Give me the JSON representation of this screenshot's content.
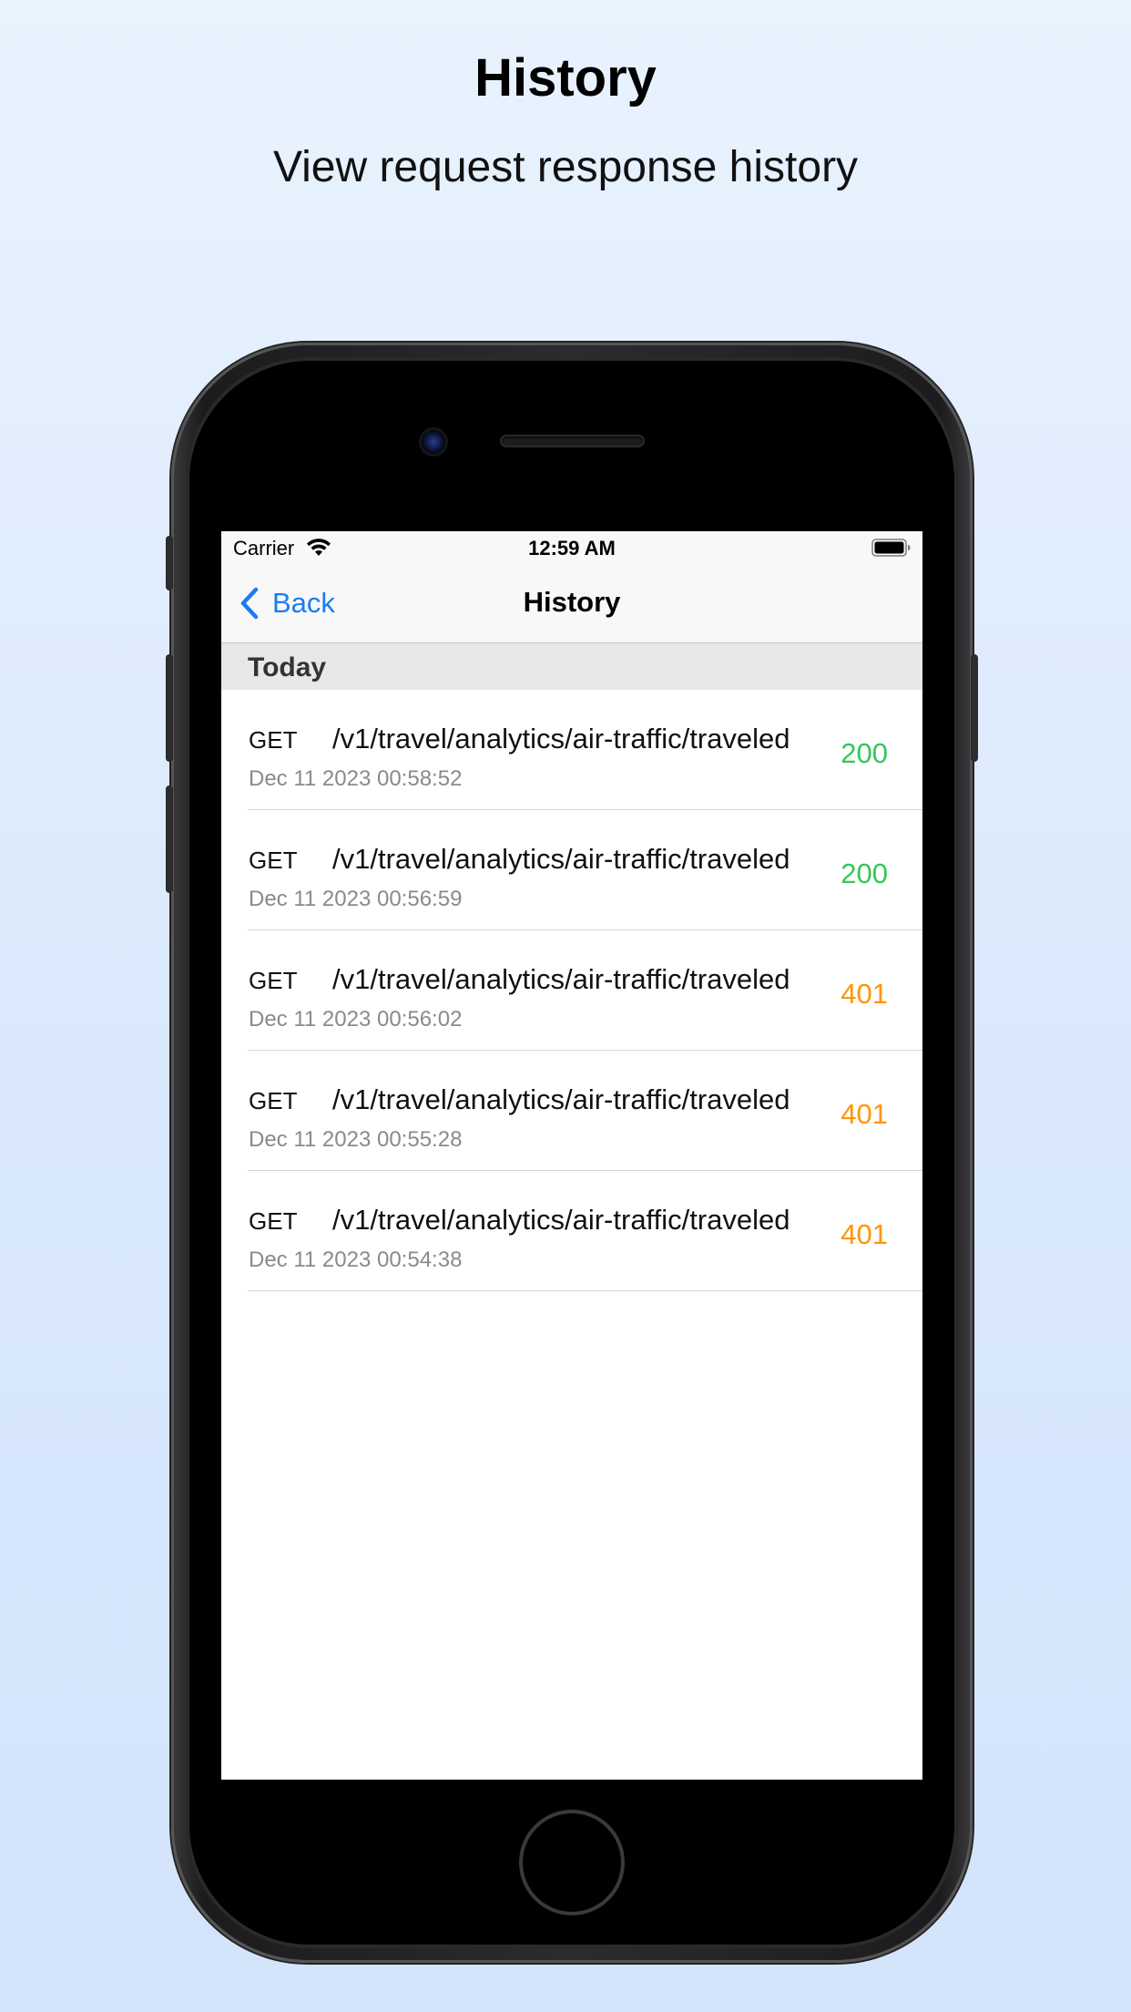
{
  "promo": {
    "title": "History",
    "subtitle": "View request response history"
  },
  "status_bar": {
    "carrier": "Carrier",
    "time": "12:59 AM",
    "icons": [
      "wifi-icon",
      "battery-icon"
    ]
  },
  "nav": {
    "back_label": "Back",
    "title": "History"
  },
  "section": {
    "label": "Today"
  },
  "colors": {
    "accent": "#1a7cf5",
    "status_ok": "#34c759",
    "status_error": "#ff9500"
  },
  "history": [
    {
      "method": "GET",
      "path": "/v1/travel/analytics/air-traffic/traveled",
      "date": "Dec 11 2023 00:58:52",
      "status": "200",
      "status_kind": "ok"
    },
    {
      "method": "GET",
      "path": "/v1/travel/analytics/air-traffic/traveled",
      "date": "Dec 11 2023 00:56:59",
      "status": "200",
      "status_kind": "ok"
    },
    {
      "method": "GET",
      "path": "/v1/travel/analytics/air-traffic/traveled",
      "date": "Dec 11 2023 00:56:02",
      "status": "401",
      "status_kind": "error"
    },
    {
      "method": "GET",
      "path": "/v1/travel/analytics/air-traffic/traveled",
      "date": "Dec 11 2023 00:55:28",
      "status": "401",
      "status_kind": "error"
    },
    {
      "method": "GET",
      "path": "/v1/travel/analytics/air-traffic/traveled",
      "date": "Dec 11 2023 00:54:38",
      "status": "401",
      "status_kind": "error"
    }
  ]
}
